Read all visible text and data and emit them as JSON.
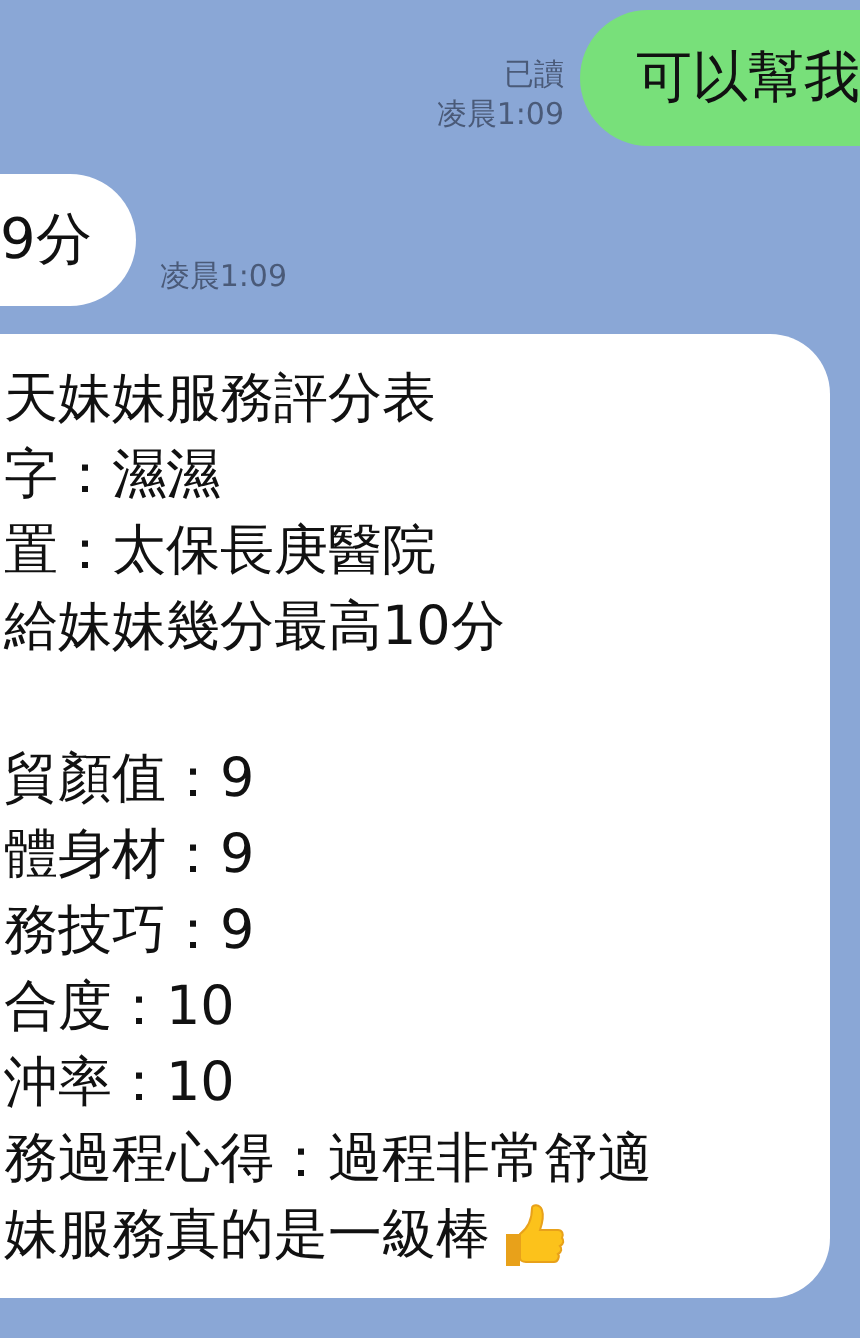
{
  "messages": [
    {
      "kind": "sent",
      "text": "可以幫我",
      "read_label": "已讀",
      "time": "凌晨1:09"
    },
    {
      "kind": "received",
      "text": "9分",
      "time": "凌晨1:09"
    },
    {
      "kind": "received_long",
      "paragraphs": [
        [
          "天妹妹服務評分表",
          "字：濕濕",
          "置：太保長庚醫院",
          "給妹妹幾分最高10分"
        ],
        [
          "貿顏值：9",
          "體身材：9",
          "務技巧：9",
          "合度：10",
          "沖率：10",
          "務過程心得：過程非常舒適",
          "妹服務真的是一級棒"
        ]
      ]
    }
  ]
}
